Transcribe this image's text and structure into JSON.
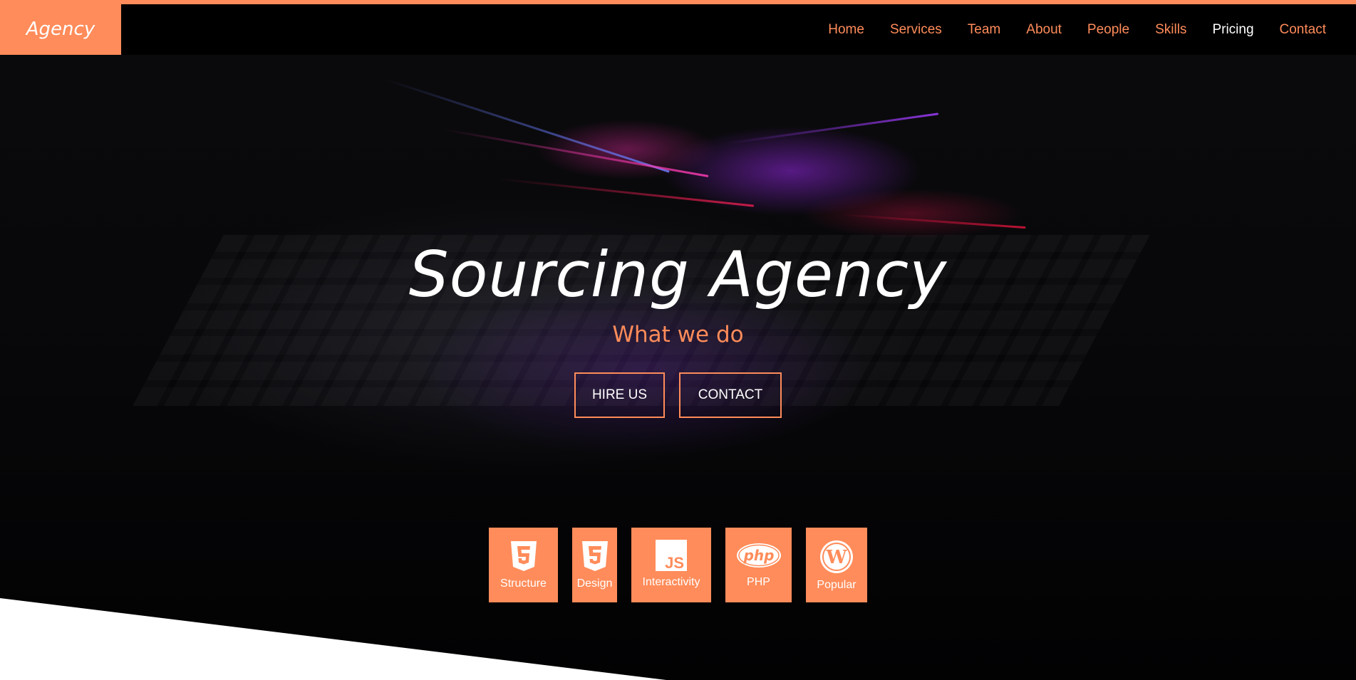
{
  "brand": {
    "name": "Agency"
  },
  "nav": {
    "items": [
      {
        "label": "Home"
      },
      {
        "label": "Services"
      },
      {
        "label": "Team"
      },
      {
        "label": "About"
      },
      {
        "label": "People"
      },
      {
        "label": "Skills"
      },
      {
        "label": "Pricing",
        "active": true
      },
      {
        "label": "Contact"
      }
    ]
  },
  "hero": {
    "title": "Sourcing Agency",
    "subtitle": "What we do",
    "buttons": {
      "hire": "HIRE US",
      "contact": "CONTACT"
    }
  },
  "tiles": [
    {
      "label": "Structure",
      "icon": "html5-icon"
    },
    {
      "label": "Design",
      "icon": "css3-icon"
    },
    {
      "label": "Interactivity",
      "icon": "js-icon"
    },
    {
      "label": "PHP",
      "icon": "php-icon"
    },
    {
      "label": "Popular",
      "icon": "wordpress-icon"
    }
  ],
  "colors": {
    "accent": "#ff8c5a",
    "background": "#000000",
    "text": "#ffffff"
  }
}
